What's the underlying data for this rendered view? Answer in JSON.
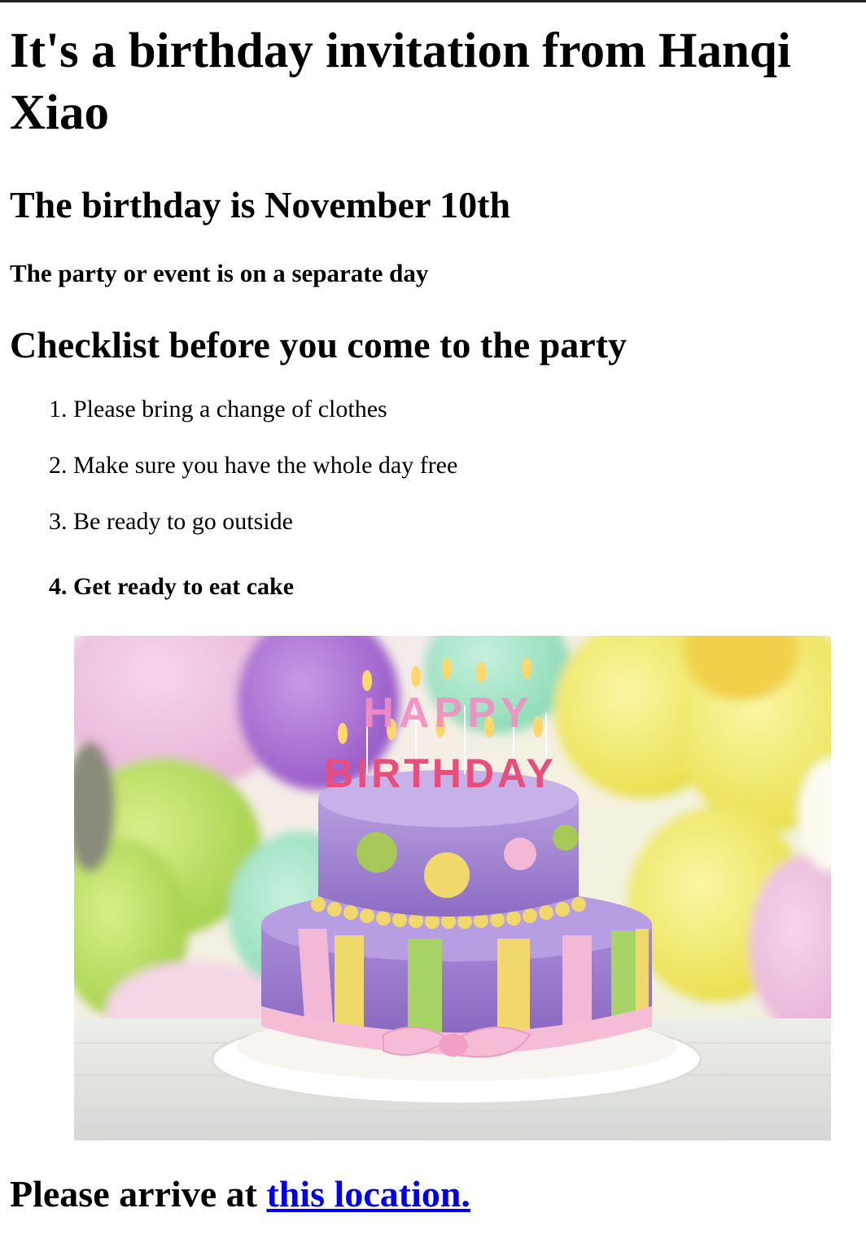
{
  "header": {
    "title": "It's a birthday invitation from Hanqi Xiao",
    "birthday": "The birthday is November 10th",
    "party_note": "The party or event is on a separate day"
  },
  "checklist": {
    "heading": "Checklist before you come to the party",
    "items": [
      "Please bring a change of clothes",
      "Make sure you have the whole day free",
      "Be ready to go outside",
      "Get ready to eat cake"
    ]
  },
  "image": {
    "candle_top": "HAPPY",
    "candle_bottom": "BIRTHDAY"
  },
  "footer": {
    "prefix": "Please arrive at ",
    "link_text": "this location."
  }
}
